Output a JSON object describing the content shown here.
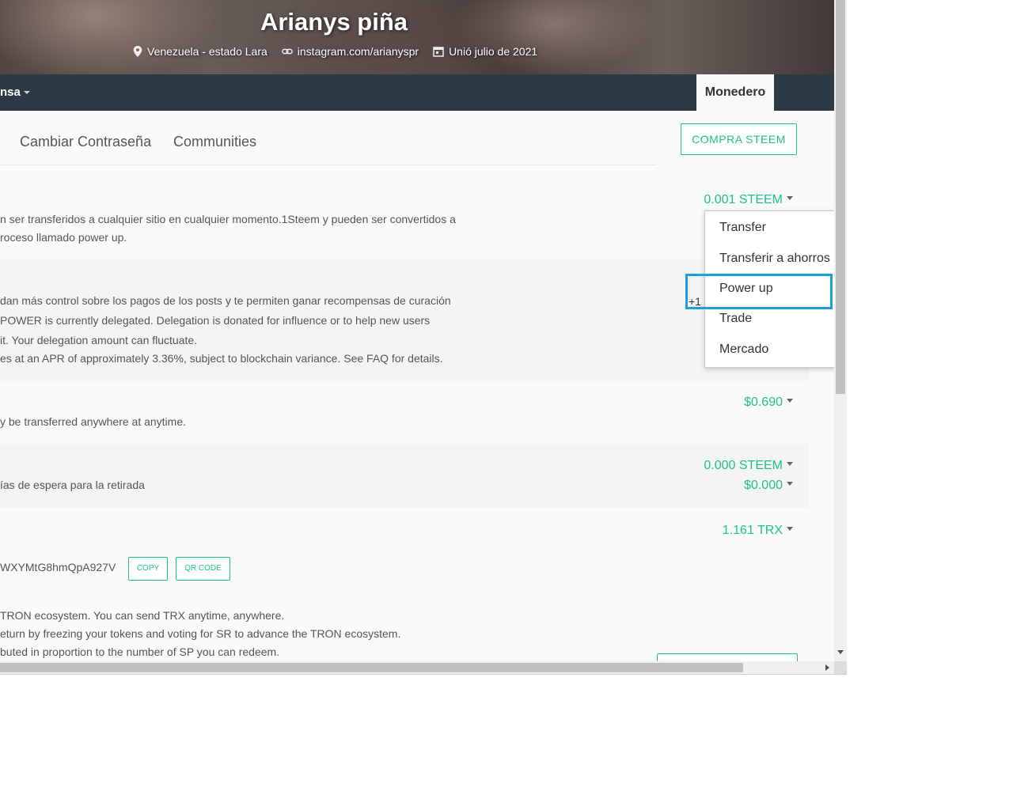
{
  "profile": {
    "name": "Arianys piña",
    "location": "Venezuela - estado Lara",
    "website": "instagram.com/arianyspr",
    "joined": "Unió julio de 2021"
  },
  "nav": {
    "left_partial": "nsa",
    "wallet_tab": "Monedero"
  },
  "subnav": {
    "change_password": "Cambiar Contraseña",
    "communities": "Communities",
    "buy_button": "COMPRA STEEM"
  },
  "steem": {
    "amount": "0.001 STEEM",
    "desc_line1": "n ser transferidos a cualquier sitio en cualquier momento.1Steem y pueden ser convertidos a",
    "desc_line2": "roceso llamado power up."
  },
  "steem_power": {
    "desc_line1": "dan más control sobre los pagos de los posts y te permiten ganar recompensas de curación",
    "desc_line2": "POWER is currently delegated. Delegation is donated for influence or to help new users",
    "desc_line3": "it. Your delegation amount can fluctuate.",
    "desc_line4": "es at an APR of approximately 3.36%, subject to blockchain variance. See FAQ for details.",
    "partial_value": "+1"
  },
  "steem_dollars": {
    "amount": "$0.690",
    "desc": "y be transferred anywhere at anytime."
  },
  "savings": {
    "amount_steem": "0.000 STEEM",
    "amount_usd": "$0.000",
    "desc": "ías de espera para la retirada"
  },
  "tron": {
    "amount": "1.161 TRX",
    "address_partial": "WXYMtG8hmQpA927V",
    "copy_button": "COPY",
    "qr_button": "QR CODE",
    "desc_line1": "TRON ecosystem. You can send TRX anytime, anywhere.",
    "desc_line2": "eturn by freezing your tokens and voting for SR to advance the TRON ecosystem.",
    "desc_line3": "buted in proportion to the number of SP you can redeem."
  },
  "dropdown": {
    "items": [
      "Transfer",
      "Transferir a ahorros",
      "Power up",
      "Trade",
      "Mercado"
    ]
  },
  "colors": {
    "accent": "#1fbf8f",
    "navbar": "#2c3a46",
    "highlight": "#1a9ee0"
  }
}
